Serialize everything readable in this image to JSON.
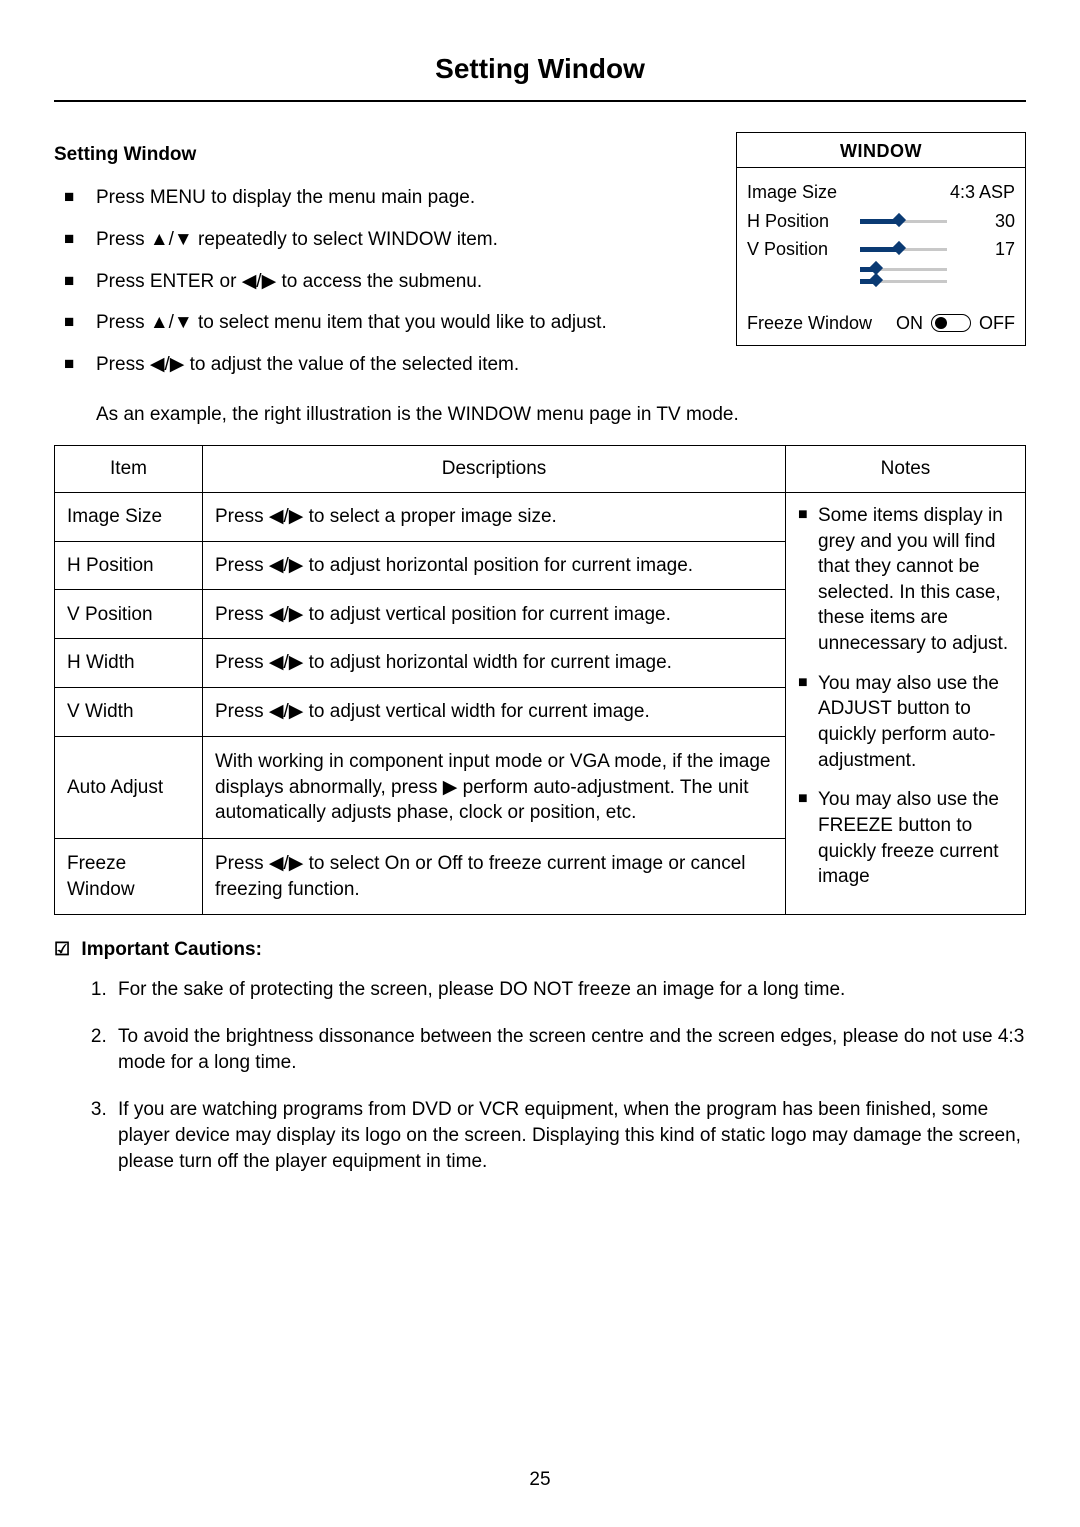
{
  "page": {
    "title": "Setting Window",
    "number": "25"
  },
  "section": {
    "heading": "Setting Window"
  },
  "steps": [
    "Press MENU to display the menu main page.",
    "Press ▲/▼ repeatedly to select WINDOW item.",
    "Press ENTER or ◀/▶ to access the submenu.",
    "Press ▲/▼ to select menu item that you would like to adjust.",
    "Press ◀/▶ to adjust the value of the selected item."
  ],
  "steps_note": "As an example, the right illustration is the WINDOW menu page in TV mode.",
  "osd": {
    "title": "WINDOW",
    "rows": [
      {
        "label": "Image Size",
        "value": "4:3 ASP",
        "kind": "text"
      },
      {
        "label": "H Position",
        "value": "30",
        "kind": "slider",
        "pct": 45
      },
      {
        "label": "V Position",
        "value": "17",
        "kind": "slider",
        "pct": 45
      },
      {
        "label": "",
        "value": "",
        "kind": "slider",
        "pct": 18
      },
      {
        "label": "",
        "value": "",
        "kind": "slider",
        "pct": 18
      }
    ],
    "freeze": {
      "label": "Freeze Window",
      "on": "ON",
      "off": "OFF",
      "state": "ON"
    }
  },
  "table": {
    "headers": {
      "item": "Item",
      "desc": "Descriptions",
      "notes": "Notes"
    },
    "rows": [
      {
        "item": "Image Size",
        "desc": "Press ◀/▶ to select a proper image size."
      },
      {
        "item": "H Position",
        "desc": "Press ◀/▶ to adjust horizontal position for current image."
      },
      {
        "item": "V Position",
        "desc": "Press ◀/▶ to adjust vertical position for current image."
      },
      {
        "item": "H Width",
        "desc": "Press ◀/▶ to adjust horizontal width for current image."
      },
      {
        "item": "V Width",
        "desc": "Press ◀/▶ to adjust vertical width for current image."
      },
      {
        "item": "Auto Adjust",
        "desc": "With working in component input mode or VGA mode, if the image displays abnormally, press ▶ perform auto-adjustment. The unit automatically adjusts phase, clock or position, etc."
      },
      {
        "item": "Freeze Window",
        "desc": "Press ◀/▶ to select On or Off to freeze current image or cancel freezing function."
      }
    ],
    "notes": [
      "Some items display in grey and you will find that they cannot be selected. In this case, these items are unnecessary to adjust.",
      "You may also use the ADJUST button to quickly perform auto-adjustment.",
      "You may also use the FREEZE button to quickly freeze current image"
    ]
  },
  "cautions": {
    "heading": "Important Cautions:",
    "items": [
      "For the sake of protecting the screen, please DO NOT freeze an image for a long time.",
      "To avoid the brightness dissonance between the screen centre and the screen edges, please do not use 4:3 mode for a long time.",
      "If you are watching programs from DVD or VCR equipment, when the program has been finished, some player device may display its logo on the screen. Displaying this kind of static logo may damage the screen, please turn off the player equipment in time."
    ]
  }
}
